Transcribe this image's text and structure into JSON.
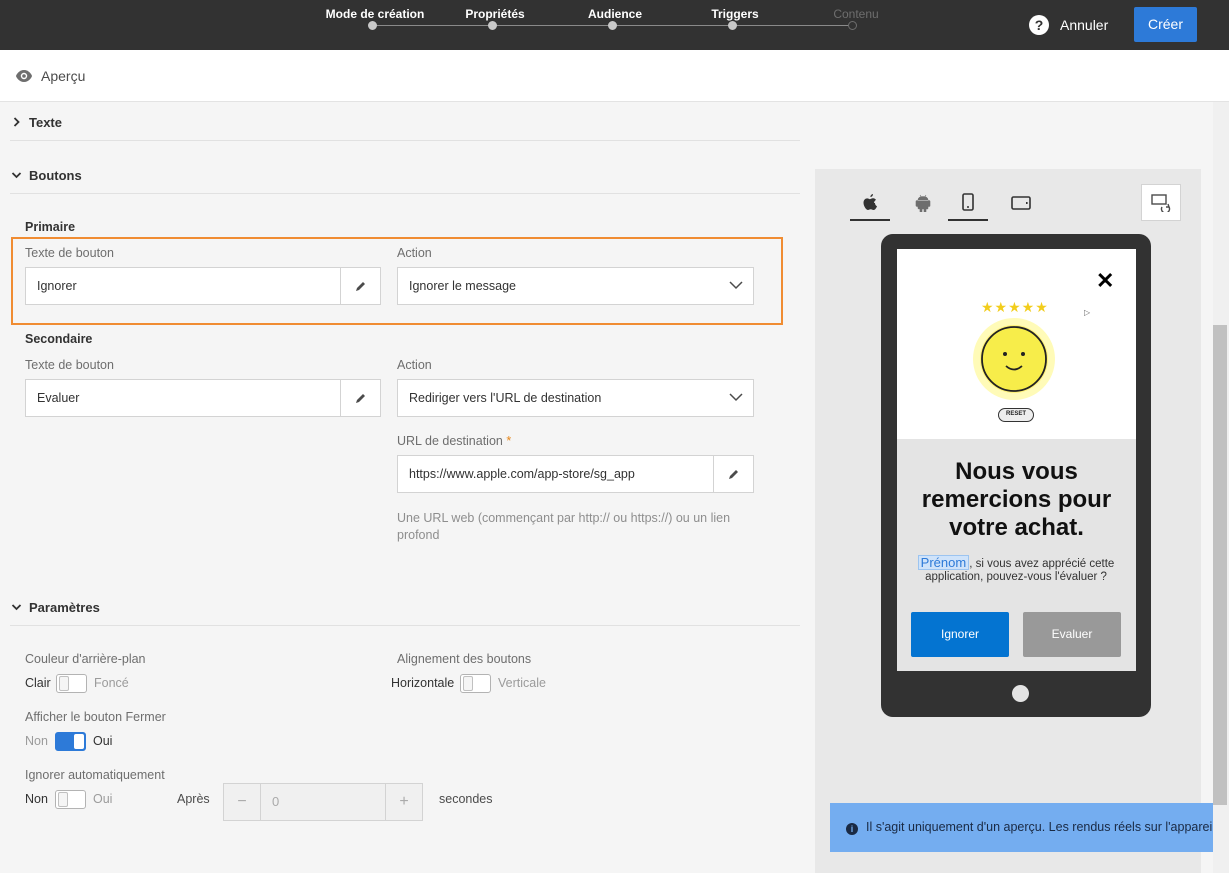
{
  "wizard": {
    "steps": [
      {
        "label": "Mode de création",
        "enabled": true
      },
      {
        "label": "Propriétés",
        "enabled": true
      },
      {
        "label": "Audience",
        "enabled": true
      },
      {
        "label": "Triggers",
        "enabled": true
      },
      {
        "label": "Contenu",
        "enabled": false
      }
    ],
    "help": "?",
    "cancel_label": "Annuler",
    "create_label": "Créer",
    "accent": "#2d7ad8"
  },
  "preview_header": {
    "label": "Aperçu",
    "icon": "eye-icon"
  },
  "sections": {
    "texte": "Texte",
    "boutons": "Boutons",
    "parametres": "Paramètres"
  },
  "primary": {
    "heading": "Primaire",
    "text_label": "Texte de bouton",
    "text_value": "Ignorer",
    "action_label": "Action",
    "action_value": "Ignorer le message"
  },
  "secondary": {
    "heading": "Secondaire",
    "text_label": "Texte de bouton",
    "text_value": "Evaluer",
    "action_label": "Action",
    "action_value": "Rediriger vers l'URL de destination",
    "url_label": "URL de destination",
    "url_required": "*",
    "url_value": "https://www.apple.com/app-store/sg_app",
    "url_hint": "Une URL web (commençant par http:// ou https://) ou un lien profond"
  },
  "params": {
    "bg_label": "Couleur d'arrière-plan",
    "bg_off": "Clair",
    "bg_on": "Foncé",
    "align_label": "Alignement des boutons",
    "align_off": "Horizontale",
    "align_on": "Verticale",
    "close_label": "Afficher le bouton Fermer",
    "close_off": "Non",
    "close_on": "Oui",
    "auto_label": "Ignorer automatiquement",
    "auto_off": "Non",
    "auto_on": "Oui",
    "after": "Après",
    "minus": "−",
    "plus": "+",
    "seconds_value": "0",
    "seconds_unit": "secondes"
  },
  "preview": {
    "close_symbol": "✕",
    "stars": "★★★★★",
    "reset": "RESET",
    "title": "Nous vous remercions pour votre achat.",
    "prenom": "Prénom",
    "body": ", si vous avez apprécié cette application, pouvez-vous l'évaluer ?",
    "btn_primary": "Ignorer",
    "btn_secondary": "Evaluer",
    "toast": "Il s'agit uniquement d'un aperçu. Les rendus réels sur l'appareil"
  }
}
